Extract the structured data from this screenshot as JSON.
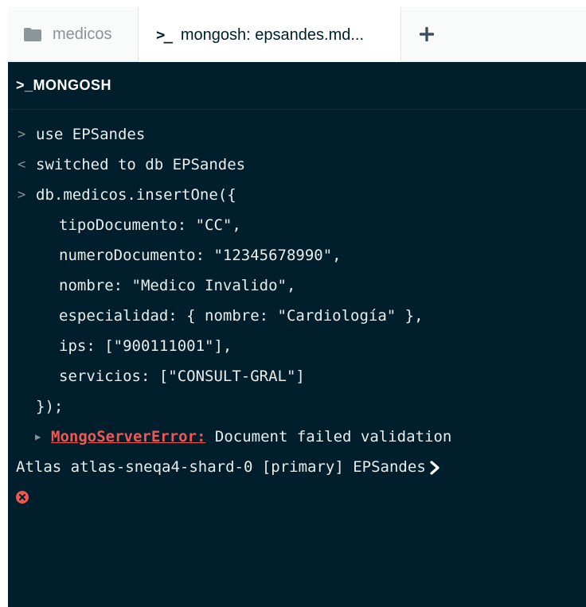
{
  "tabs": {
    "inactive_label": "medicos",
    "active_label": "mongosh: epsandes.md...",
    "active_prompt_glyph": ">_",
    "add_glyph": "+"
  },
  "shell": {
    "header": ">_MONGOSH",
    "lines": {
      "in1": "use EPSandes",
      "out1": "switched to db EPSandes",
      "in2": "db.medicos.insertOne({",
      "c1": "tipoDocumento: \"CC\",",
      "c2": "numeroDocumento: \"12345678990\",",
      "c3": "nombre: \"Medico Invalido\",",
      "c4": "especialidad: { nombre: \"Cardiología\" },",
      "c5": "ips: [\"900111001\"],",
      "c6": "servicios: [\"CONSULT-GRAL\"]",
      "c7": "});"
    },
    "error": {
      "name": "MongoServerError:",
      "message": " Document failed validation"
    },
    "prompt": "Atlas atlas-sneqa4-shard-0 [primary] EPSandes"
  },
  "markers": {
    "input": ">",
    "output": "<"
  },
  "colors": {
    "shell_bg": "#001e2b",
    "error_red": "#ef5752",
    "text": "#e8edeb",
    "muted": "#889397"
  }
}
